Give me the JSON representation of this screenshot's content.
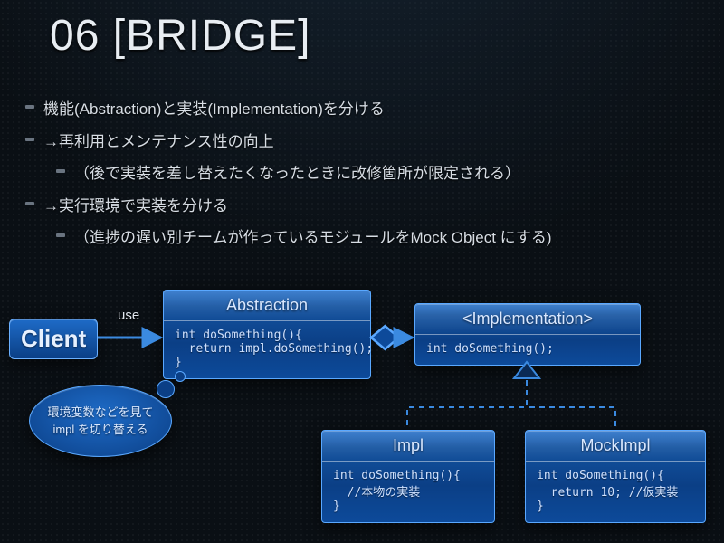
{
  "title": "06 [BRIDGE]",
  "bullets": [
    {
      "text": "機能(Abstraction)と実装(Implementation)を分ける",
      "sub": false
    },
    {
      "text": "→再利用とメンテナンス性の向上",
      "sub": false
    },
    {
      "text": "（後で実装を差し替えたくなったときに改修箇所が限定される）",
      "sub": true
    },
    {
      "text": "→実行環境で実装を分ける",
      "sub": false
    },
    {
      "text": "（進捗の遅い別チームが作っているモジュールをMock Object にする)",
      "sub": true
    }
  ],
  "client_label": "Client",
  "labels": {
    "use": "use",
    "impl": "impl"
  },
  "bubble": "環境変数などを見て\nimpl を切り替える",
  "boxes": {
    "abstraction": {
      "title": "Abstraction",
      "code": "int doSomething(){\n  return impl.doSomething();\n}"
    },
    "implementation": {
      "title": "<Implementation>",
      "code": "int doSomething();"
    },
    "impl": {
      "title": "Impl",
      "code": "int doSomething(){\n  //本物の実装\n}"
    },
    "mockimpl": {
      "title": "MockImpl",
      "code": "int doSomething(){\n  return 10; //仮実装\n}"
    }
  },
  "colors": {
    "box_border": "#5aa8ff",
    "box_fill": "#0d4a9a",
    "line": "#3b8ae0",
    "dash": "#3b8ae0"
  }
}
